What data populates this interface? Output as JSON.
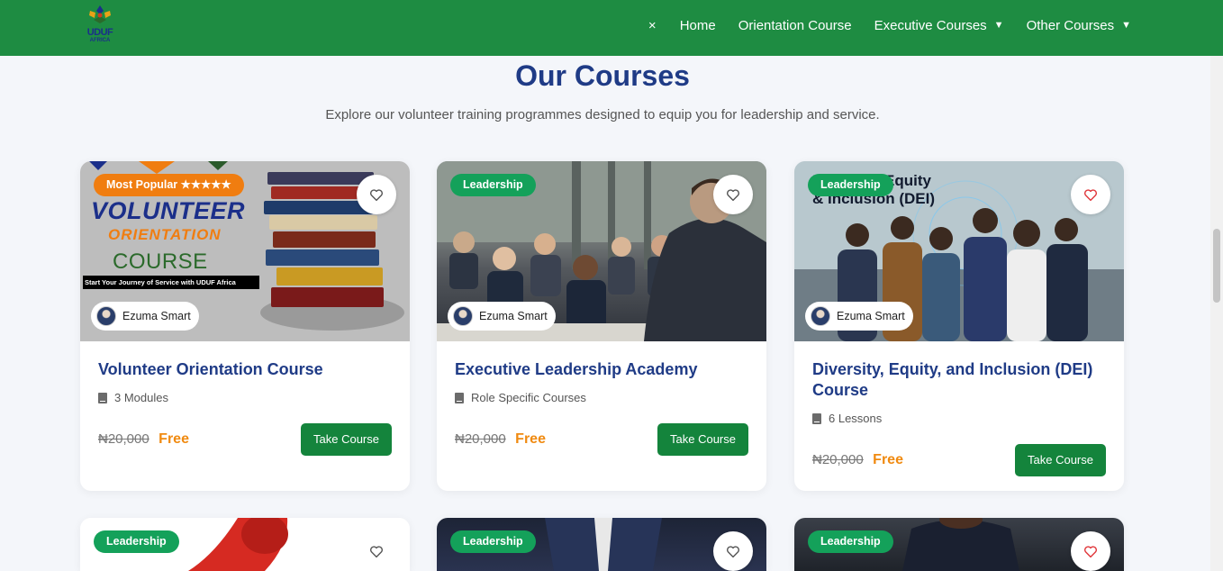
{
  "brand": {
    "logo_text": "UDUF",
    "logo_subtext": "AFRICA"
  },
  "nav": {
    "close_icon": "×",
    "items": [
      {
        "label": "Home",
        "has_dropdown": false
      },
      {
        "label": "Orientation Course",
        "has_dropdown": false
      },
      {
        "label": "Executive Courses",
        "has_dropdown": true
      },
      {
        "label": "Other Courses",
        "has_dropdown": true
      }
    ],
    "caret": "▼"
  },
  "section": {
    "title": "Our Courses",
    "subtitle": "Explore our volunteer training programmes designed to equip you for leadership and service."
  },
  "colors": {
    "header": "#1e8c42",
    "title": "#1f3b86",
    "badge": "#14a15a",
    "popular": "#f07d10",
    "free": "#f08a10",
    "button": "#14843c"
  },
  "cards": [
    {
      "badge": "Most Popular ★★★★★",
      "image_text": {
        "line1": "VOLUNTEER",
        "line2": "ORIENTATION",
        "line3": "COURSE",
        "tagline": "Start Your Journey of Service with UDUF Africa"
      },
      "author": "Ezuma Smart",
      "title": "Volunteer Orientation Course",
      "meta": "3 Modules",
      "old_price": "₦20,000",
      "price": "Free",
      "button": "Take Course",
      "fav_icon": "heart-outline-icon"
    },
    {
      "badge": "Leadership",
      "author": "Ezuma Smart",
      "title": "Executive Leadership Academy",
      "meta": "Role Specific Courses",
      "old_price": "₦20,000",
      "price": "Free",
      "button": "Take Course",
      "fav_icon": "heart-outline-icon"
    },
    {
      "badge": "Leadership",
      "image_text": {
        "line1": "Diversity, Equity",
        "line2": "& Inclusion (DEI)"
      },
      "author": "Ezuma Smart",
      "title": "Diversity, Equity, and Inclusion (DEI) Course",
      "meta": "6 Lessons",
      "old_price": "₦20,000",
      "price": "Free",
      "button": "Take Course",
      "fav_icon": "heart-outline-red-icon"
    },
    {
      "badge": "Leadership",
      "fav_icon": "heart-outline-icon"
    },
    {
      "badge": "Leadership",
      "fav_icon": "heart-outline-icon"
    },
    {
      "badge": "Leadership",
      "fav_icon": "heart-outline-red-icon"
    }
  ]
}
